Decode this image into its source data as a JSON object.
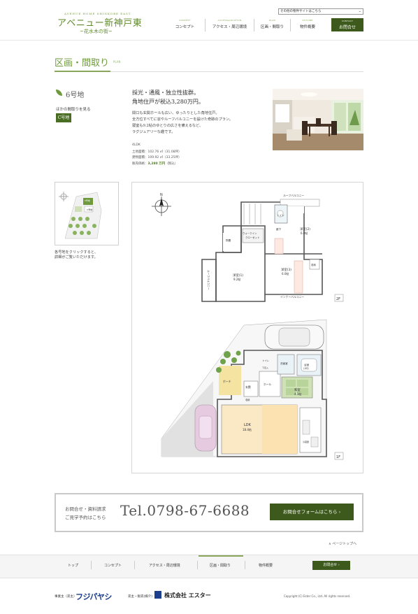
{
  "header": {
    "logo_sub": "AVENUE HOME SHINKOBE EAST",
    "logo_title": "アベニュー新神戸東",
    "logo_tag": "~花水木の街~",
    "site_select": "その他の物件サイトはこちら",
    "nav": [
      {
        "en": "CONCEPT",
        "label": "コンセプト"
      },
      {
        "en": "ACCESS&LOCATION",
        "label": "アクセス・周辺環境"
      },
      {
        "en": "PLAN",
        "label": "区画・間取り"
      },
      {
        "en": "OUTLINE",
        "label": "物件概要"
      }
    ],
    "contact": {
      "en": "CONTACT",
      "label": "お問合せ"
    }
  },
  "section": {
    "title": "区画・間取り",
    "title_en": "PLAN"
  },
  "lot": {
    "number": "6号地",
    "other_label": "ほかの間取りを見る",
    "c_button": "C号地",
    "headline1": "採光・通風・独立性抜群。",
    "headline2": "角地住戸が税込3,280万円。",
    "description": [
      "間口も玄関ホールも広い、ゆったりとした角地住戸。",
      "全方位すべてに窓やルーフバルコニーを設けた奇跡のプラン。",
      "寝室も9.2帖のゆとりの広さを備えるなど、",
      "ラグジュアリーな趣です。"
    ],
    "layout_type": "4LDK",
    "land_area": "土地面積：102.76 ㎡（31.08坪）",
    "floor_area": "建物面積：109.92 ㎡（33.25坪）",
    "price_label": "販売価格：",
    "price_value": "3,280 万円",
    "price_tax": "（税込）"
  },
  "sitemap": {
    "caption1": "各号地をクリックすると、",
    "caption2": "詳細がご覧いただけます。",
    "c_label": "C号地",
    "lot6_label": "6号地"
  },
  "floorplan": {
    "floor2": {
      "label": "2F",
      "roof_balcony_top": "ルーフバルコニー",
      "toilet": "トイレ",
      "hall": "廊下",
      "walk_in_closet": "ウォークイン\nクローゼット",
      "storage": "物置",
      "closet1": "クローゼット",
      "closet2": "クローゼット",
      "storage2": "収納",
      "room2": "洋室(2)",
      "room2_size": "6.0帖",
      "room1": "洋室(1)",
      "room1_size": "9.2帖",
      "room3": "洋室(3)",
      "room3_size": "6.0帖",
      "roof_balcony_left": "ルーフバルコニー",
      "inner_balcony": "インナーバルコニー"
    },
    "floor1": {
      "label": "1F",
      "entrance": "玄関",
      "hall": "ホール",
      "porch": "ポーチ",
      "washroom": "洗面室",
      "bath": "浴室",
      "bath_size": "(1坪)",
      "japanese_room": "和室",
      "japanese_size": "4.1帖",
      "ldk": "LDK",
      "ldk_size": "18.4帖",
      "toilet": "トイレ",
      "storage": "収納",
      "shoebox": "下足入",
      "fridge": "冷蔵庫"
    }
  },
  "banner": {
    "text1": "お問合せ・資料請求",
    "text2": "ご見学予約はこちら",
    "phone": "Tel.0798-67-6688",
    "form_button": "お問合せフォームはこちら ›"
  },
  "page_top": "∧ ページトップへ",
  "footer_nav": [
    "トップ",
    "コンセプト",
    "アクセス・周辺環境",
    "区画・間取り",
    "物件概要"
  ],
  "footer_contact": "お問合せ ›",
  "credits": {
    "builder_label": "事業主（売主）",
    "builder_name": "フジパヤシ",
    "seller_label": "売主・販売(媒介)",
    "seller_name": "株式会社 エスター",
    "copyright": "Copyright (C) Ester Co., Ltd. All rights reserved."
  },
  "colors": {
    "accent_green": "#6e9a3c",
    "dark_green": "#3d5a1c",
    "navy": "#1d3e8c"
  }
}
